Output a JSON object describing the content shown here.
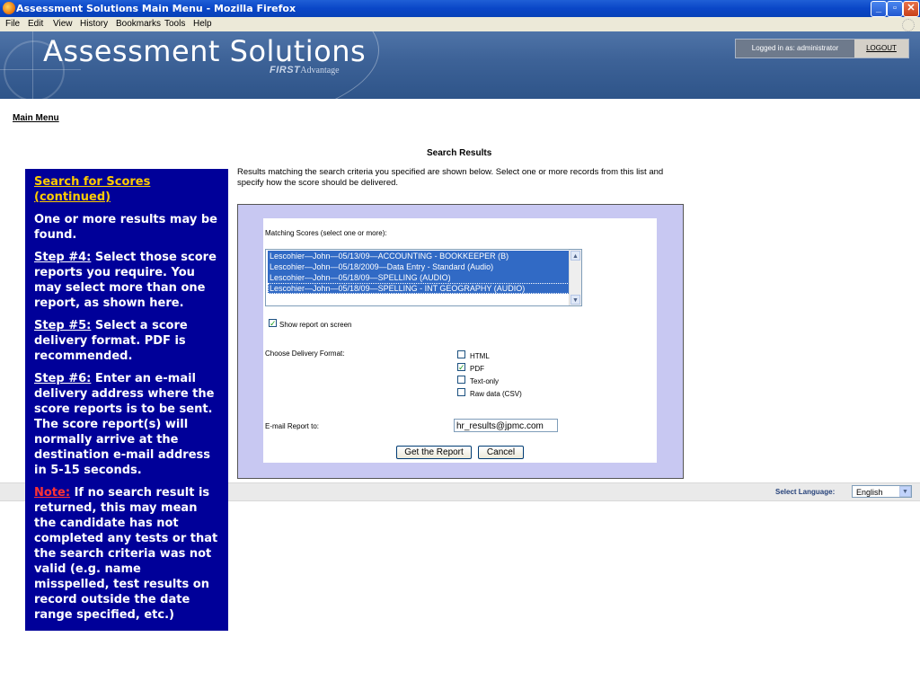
{
  "window": {
    "title": "Assessment Solutions Main Menu - Mozilla Firefox",
    "minimize": "_",
    "maximize": "▫",
    "close": "✕"
  },
  "menubar": [
    "File",
    "Edit",
    "View",
    "History",
    "Bookmarks",
    "Tools",
    "Help"
  ],
  "header": {
    "brand": "Assessment Solutions",
    "sub_brand_bold": "FIRST",
    "sub_brand_rest": "Advantage",
    "logged_in": "Logged in as: administrator",
    "logout": "LOGOUT"
  },
  "breadcrumb": "Main Menu",
  "search": {
    "title": "Search Results",
    "description": "Results matching the search criteria you specified are shown below. Select one or more records from this list and specify how the score should be delivered.",
    "matching_label": "Matching Scores (select one or more):",
    "results": [
      "Lescohier—John—05/13/09—ACCOUNTING - BOOKKEEPER (B)",
      "Lescohier—John—05/18/2009—Data Entry - Standard (Audio)",
      "Lescohier—John—05/18/09—SPELLING (AUDIO)",
      "Lescohier—John—05/18/09—SPELLING - INT GEOGRAPHY (AUDIO)"
    ],
    "show_on_screen_label": "Show report on screen",
    "show_on_screen_checked": true,
    "delivery_label": "Choose Delivery Format:",
    "formats": [
      {
        "label": "HTML",
        "checked": false
      },
      {
        "label": "PDF",
        "checked": true
      },
      {
        "label": "Text-only",
        "checked": false
      },
      {
        "label": "Raw data (CSV)",
        "checked": false
      }
    ],
    "email_label": "E-mail Report to:",
    "email_value": "hr_results@jpmc.com",
    "get_report": "Get the Report",
    "cancel": "Cancel"
  },
  "language": {
    "label": "Select Language:",
    "value": "English"
  },
  "callout": {
    "heading": "Search for Scores (continued)",
    "intro": "One or more results may be found.",
    "step4_label": "Step #4:",
    "step4_text": " Select those score reports you require.  You may select more than one report, as shown here.",
    "step5_label": "Step #5:",
    "step5_text": " Select a score delivery format.  PDF is recommended.",
    "step6_label": "Step #6:",
    "step6_text": " Enter an e-mail delivery address where the score reports is to be sent.  The score report(s) will normally arrive at the destination e-mail address in 5-15 seconds.",
    "note_label": "Note:",
    "note_text": " If no search result is returned, this may mean the candidate has not completed any tests or that the search criteria was not valid (e.g. name misspelled, test results on record outside the date range specified, etc.)"
  }
}
